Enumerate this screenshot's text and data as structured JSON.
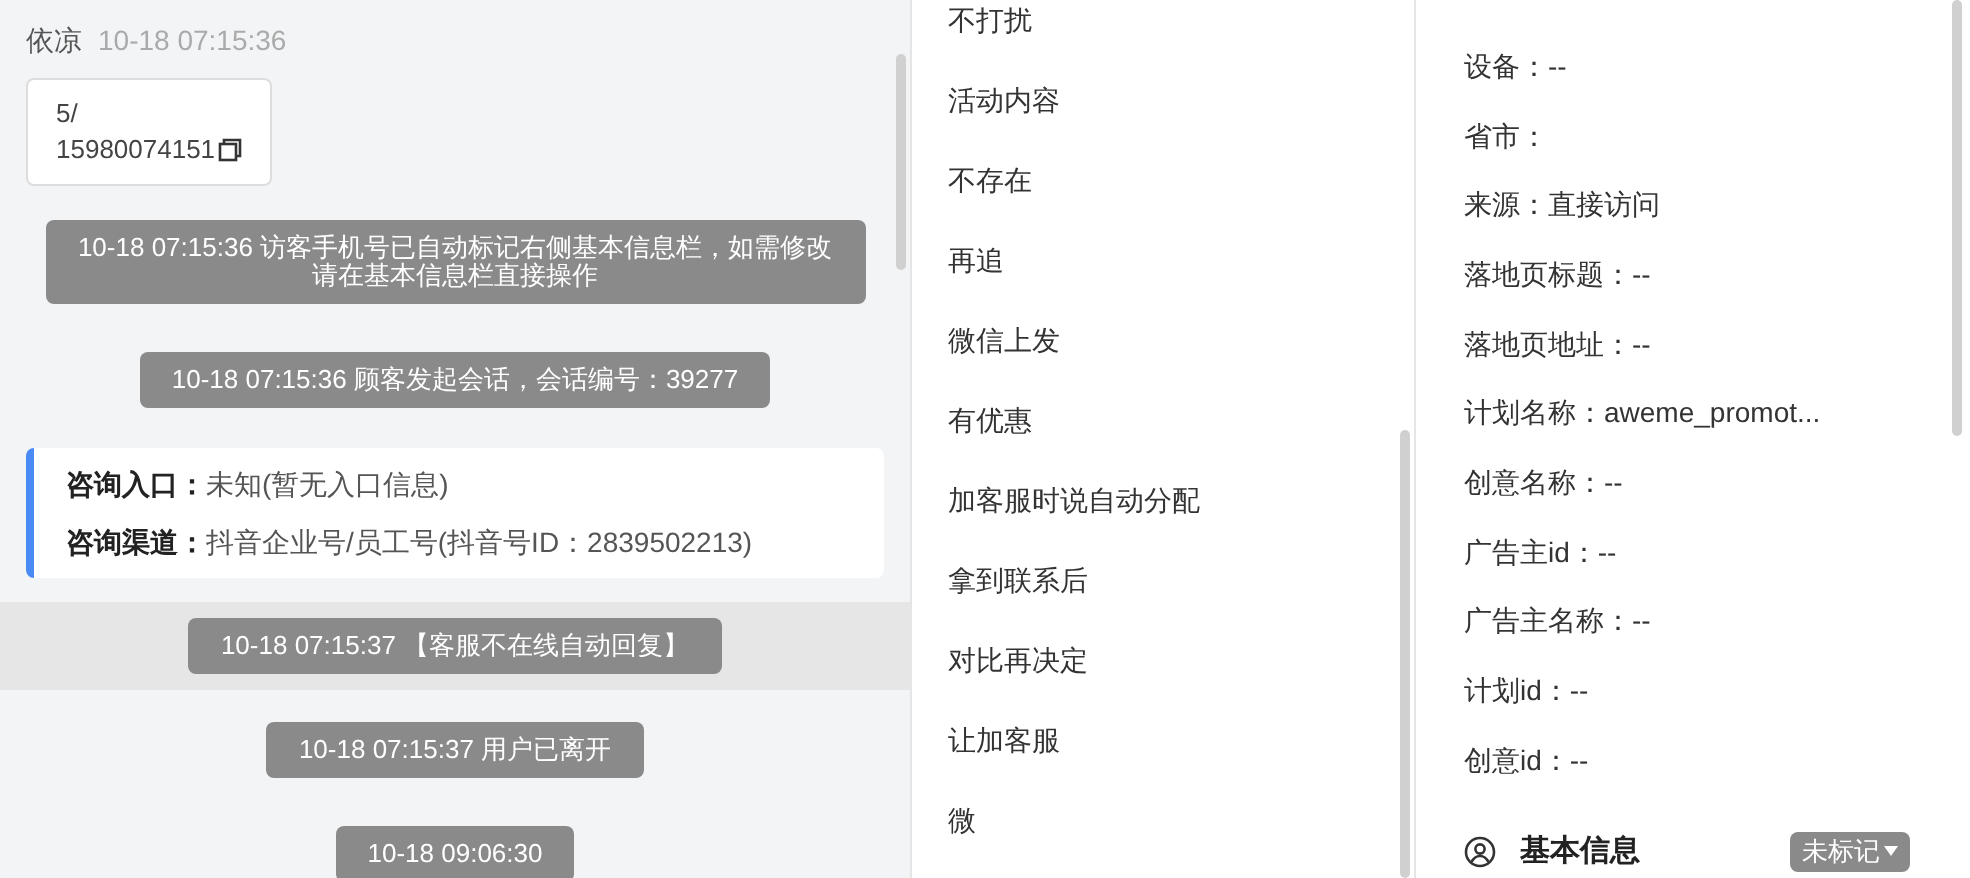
{
  "chat": {
    "sender": "依凉",
    "time": "10-18 07:15:36",
    "card_lines": [
      "5/",
      "15980074151"
    ],
    "messages": [
      {
        "kind": "system",
        "text": "10-18 07:15:36 访客手机号已自动标记右侧基本信息栏，如需修改请在基本信息栏直接操作",
        "highlighted": false
      },
      {
        "kind": "system",
        "text": "10-18 07:15:36 顾客发起会话，会话编号：39277",
        "highlighted": false
      },
      {
        "kind": "info",
        "rows": [
          {
            "label": "咨询入口：",
            "value": "未知(暂无入口信息)"
          },
          {
            "label": "咨询渠道：",
            "value": "抖音企业号/员工号(抖音号ID：2839502213)"
          }
        ]
      },
      {
        "kind": "system",
        "text": "10-18 07:15:37 【客服不在线自动回复】",
        "highlighted": true
      },
      {
        "kind": "system",
        "text": "10-18 07:15:37 用户已离开",
        "highlighted": false
      },
      {
        "kind": "system",
        "text": "10-18 09:06:30",
        "highlighted": false
      }
    ]
  },
  "tag_list": {
    "items": [
      "不打扰",
      "活动内容",
      "不存在",
      "再追",
      "微信上发",
      "有优惠",
      "加客服时说自动分配",
      "拿到联系后",
      "对比再决定",
      "让加客服",
      "微"
    ]
  },
  "details": {
    "fields": [
      "设备：--",
      "省市：",
      "来源：直接访问",
      "落地页标题：--",
      "落地页地址：--",
      "计划名称：aweme_promot...",
      "创意名称：--",
      "广告主id：--",
      "广告主名称：--",
      "计划id：--",
      "创意id：--"
    ],
    "section_title": "基本信息",
    "mark_button": "未标记"
  }
}
